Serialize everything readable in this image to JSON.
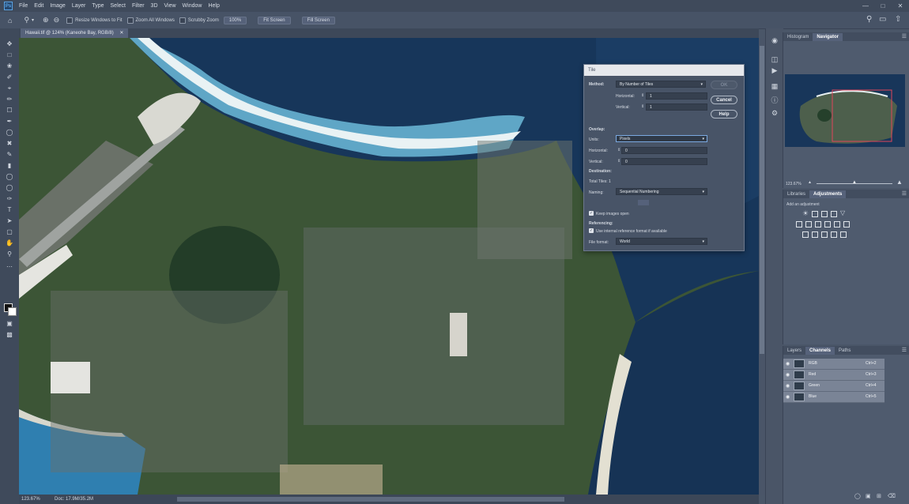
{
  "app": {
    "logo_text": "Ps"
  },
  "menu": [
    "File",
    "Edit",
    "Image",
    "Layer",
    "Type",
    "Select",
    "Filter",
    "3D",
    "View",
    "Window",
    "Help"
  ],
  "options_bar": {
    "resize_windows_label": "Resize Windows to Fit",
    "zoom_all_label": "Zoom All Windows",
    "scrubby_zoom_label": "Scrubby Zoom",
    "zoom_100_button": "100%",
    "fit_screen_button": "Fit Screen",
    "fill_screen_button": "Fill Screen"
  },
  "document": {
    "tab_title": "Hawaii.tif @ 124% (Kaneohe Bay, RGB/8)",
    "zoom": "123.67%",
    "doc_size": "Doc: 17.9M/35.2M"
  },
  "dialog": {
    "title": "Tile",
    "method_label": "Method:",
    "method_value": "By Number of Tiles",
    "horizontal_label": "Horizontal:",
    "horizontal_value": "1",
    "vertical_label": "Vertical:",
    "vertical_value": "1",
    "ok_button": "OK",
    "cancel_button": "Cancel",
    "help_button": "Help",
    "overlap_header": "Overlap:",
    "units_label": "Units:",
    "units_value": "Pixels",
    "overlap_horizontal_label": "Horizontal:",
    "overlap_horizontal_value": "0",
    "overlap_vertical_label": "Vertical:",
    "overlap_vertical_value": "0",
    "destination_header": "Destination:",
    "total_tiles": "Total Tiles: 1",
    "naming_label": "Naming:",
    "naming_value": "Sequential Numbering",
    "keep_images_open": "Keep images open",
    "referencing_header": "Referencing:",
    "use_internal_ref": "Use internal reference format if available",
    "file_format_label": "File format:",
    "file_format_value": "World"
  },
  "navigator_panel": {
    "tabs": [
      "Histogram",
      "Navigator"
    ],
    "active_tab": "Navigator",
    "zoom_value": "123.67%",
    "zoom_slider_fraction": 0.5
  },
  "adjustments_panel": {
    "tabs": [
      "Libraries",
      "Adjustments"
    ],
    "active_tab": "Adjustments",
    "add_label": "Add an adjustment"
  },
  "channels_panel": {
    "tabs": [
      "Layers",
      "Channels",
      "Paths"
    ],
    "active_tab": "Channels",
    "channels": [
      {
        "name": "RGB",
        "shortcut": "Ctrl+2"
      },
      {
        "name": "Red",
        "shortcut": "Ctrl+3"
      },
      {
        "name": "Green",
        "shortcut": "Ctrl+4"
      },
      {
        "name": "Blue",
        "shortcut": "Ctrl+5"
      }
    ]
  },
  "colors": {
    "accent": "#7ba9e0",
    "nav_box": "#e0455a"
  }
}
